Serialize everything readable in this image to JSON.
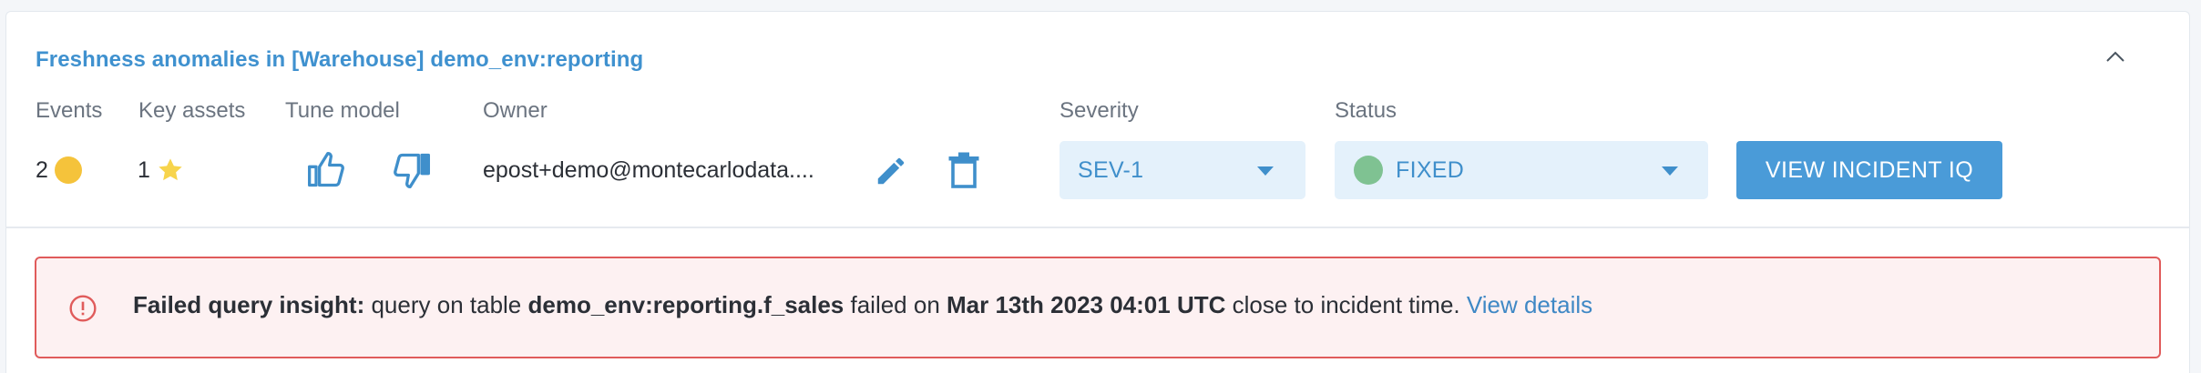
{
  "incident": {
    "title": "Freshness anomalies in [Warehouse] demo_env:reporting"
  },
  "columns": {
    "events": "Events",
    "key_assets": "Key assets",
    "tune_model": "Tune model",
    "owner": "Owner",
    "severity": "Severity",
    "status": "Status"
  },
  "values": {
    "events_count": "2",
    "key_assets_count": "1",
    "owner_email": "epost+demo@montecarlodata....",
    "severity_selected": "SEV-1",
    "status_selected": "FIXED"
  },
  "actions": {
    "view_incident_iq": "VIEW INCIDENT IQ"
  },
  "alert": {
    "label": "Failed query insight:",
    "text_1": " query on table ",
    "table": "demo_env:reporting.f_sales",
    "text_2": " failed on ",
    "timestamp": "Mar 13th 2023 04:01 UTC",
    "text_3": " close to incident time. ",
    "link": "View details"
  },
  "colors": {
    "accent": "#3f91cf",
    "button": "#4a9bd8",
    "dropdown_bg": "#e4f1fb",
    "alert_border": "#e05b5b",
    "alert_bg": "#fdf1f2",
    "status_fixed": "#7fc292",
    "events_dot": "#f5c33b",
    "star": "#f7d44c"
  },
  "icons": [
    "chevron-up-icon",
    "events-dot-icon",
    "star-icon",
    "thumbs-up-icon",
    "thumbs-down-icon",
    "pencil-icon",
    "trash-icon",
    "caret-down-icon",
    "status-dot-icon",
    "alert-circle-icon"
  ]
}
